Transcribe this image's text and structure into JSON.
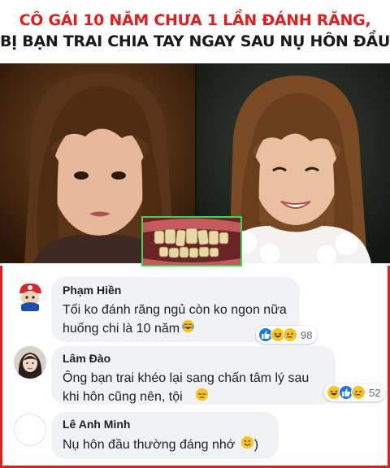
{
  "headline": {
    "line1": "CÔ GÁI 10 NĂM CHƯA 1 LẦN ĐÁNH RĂNG,",
    "line2": "BỊ BẠN TRAI CHIA TAY NGAY SAU NỤ HÔN ĐẦU"
  },
  "colors": {
    "headline_red": "#e01e1e",
    "frame_red": "#e01e1e",
    "inset_border": "#39d65a",
    "bubble_bg": "#f0f2f5",
    "like_blue": "#1877f2"
  },
  "comments": [
    {
      "name": "Phạm Hiền",
      "text_line1": "Tối ko đánh răng ngủ còn ko ngon nữa",
      "text_line2": "huống chi là 10 năm",
      "emoji": "laughing-tears",
      "reactions": [
        "like",
        "haha",
        "sad"
      ],
      "reaction_count": "98"
    },
    {
      "name": "Lâm Đào",
      "text_line1": "Ông bạn trai khéo lại sang chấn tâm lý sau",
      "text_line2": "khi hôn cũng nên, tội",
      "emoji": "disappointed",
      "reactions": [
        "haha",
        "like",
        "sad"
      ],
      "reaction_count": "52"
    },
    {
      "name": "Lê Anh Minh",
      "text_line1": "Nụ hôn đầu thường đáng nhớ",
      "emoji": "smile"
    }
  ]
}
